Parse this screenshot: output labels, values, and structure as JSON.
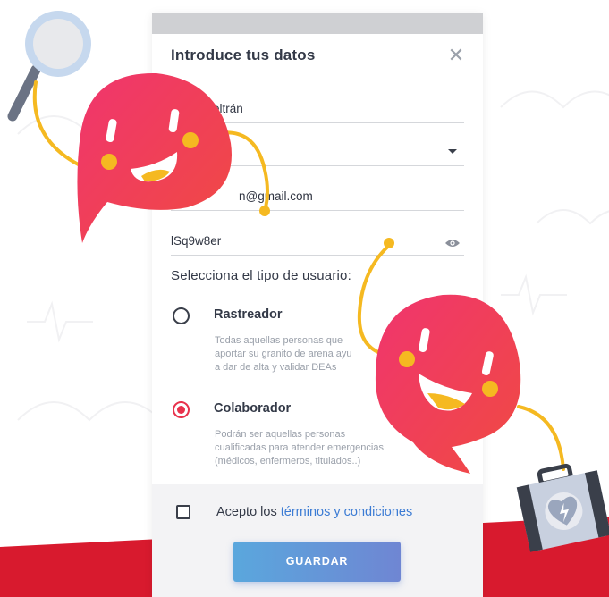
{
  "dialog": {
    "title": "Introduce tus datos",
    "close_icon": "close-icon"
  },
  "fields": {
    "name_value": "Beltrán",
    "select_value": "",
    "email_value": "n@gmail.com",
    "password_value": "lSq9w8er",
    "password_icon": "eye-icon"
  },
  "user_type": {
    "title": "Selecciona el tipo de usuario:",
    "options": [
      {
        "label": "Rastreador",
        "desc_lines": [
          "Todas aquellas personas que",
          "aportar su granito de arena ayu",
          "a dar de alta y validar DEAs"
        ],
        "checked": false
      },
      {
        "label": "Colaborador",
        "desc_lines": [
          "Podrán ser aquellas personas",
          "cualificadas para atender emergencias",
          "(médicos, enfermeros, titulados..)"
        ],
        "checked": true
      }
    ]
  },
  "terms": {
    "prefix": "Acepto los ",
    "link": "términos y condiciones",
    "checked": false
  },
  "save_label": "GUARDAR",
  "colors": {
    "accent_red": "#e8324c",
    "link_blue": "#3b7bd4",
    "button_gradient": [
      "#5aa7dd",
      "#6f86d3"
    ],
    "mascot_gradient": [
      "#f0356e",
      "#f04a42"
    ],
    "band_red": "#d81a2e"
  }
}
